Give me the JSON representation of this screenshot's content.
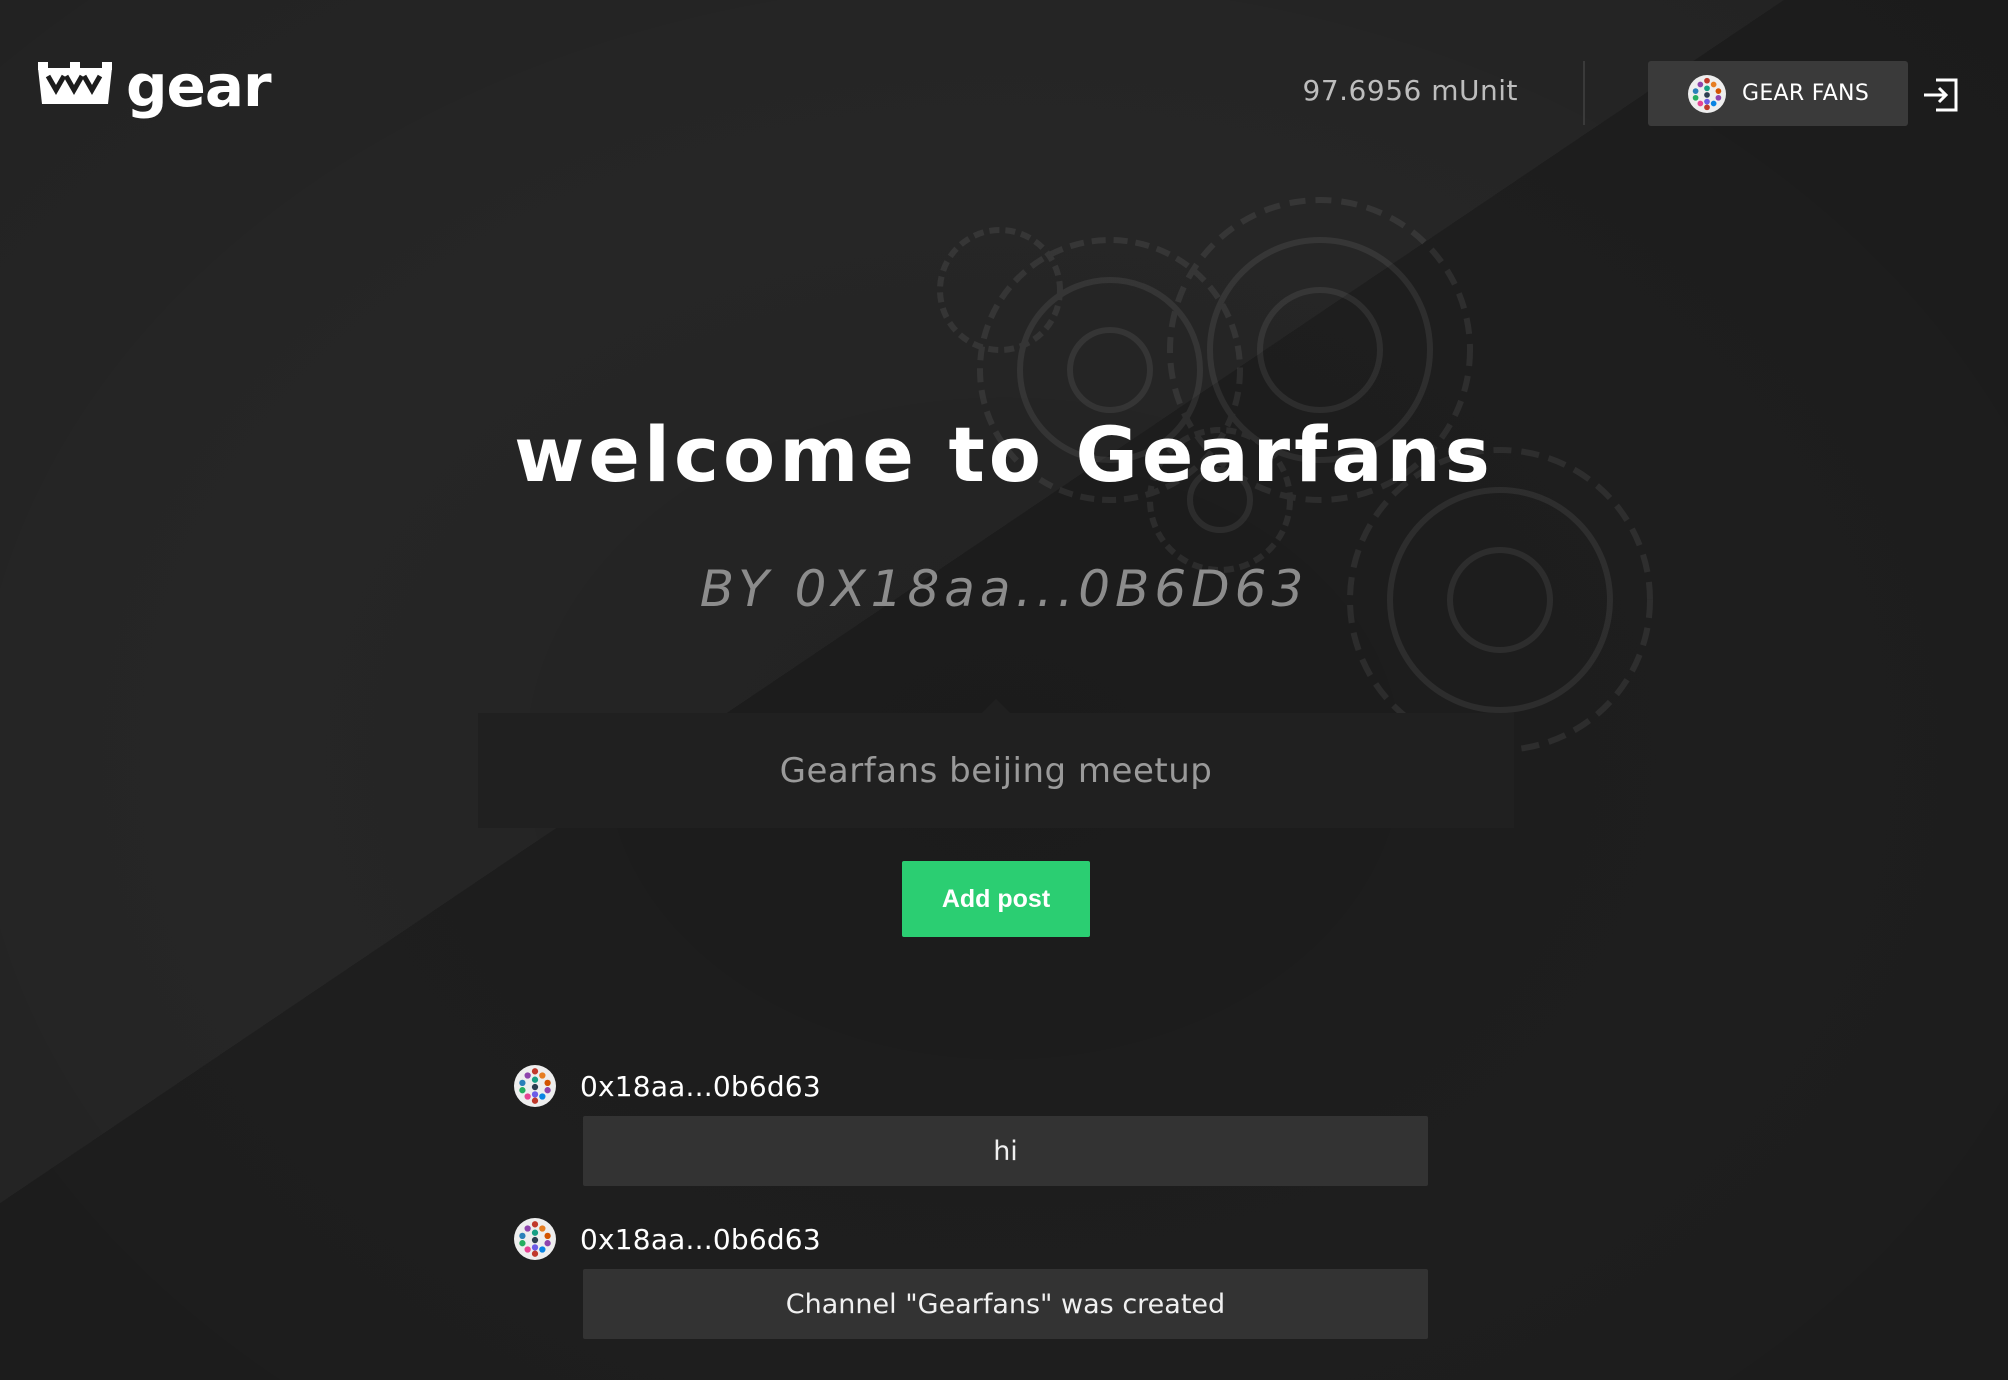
{
  "header": {
    "logo_text": "gear",
    "balance": "97.6956 mUnit",
    "account_name": "GEAR FANS",
    "icons": {
      "logo": "gear-logo-icon",
      "avatar": "polkadot-identicon",
      "logout": "logout-icon"
    }
  },
  "hero": {
    "title": "welcome to Gearfans",
    "owner": "BY 0X18aa...0B6D63",
    "description": "Gearfans beijing meetup",
    "add_post_label": "Add post"
  },
  "posts": [
    {
      "author": "0x18aa...0b6d63",
      "text": "hi"
    },
    {
      "author": "0x18aa...0b6d63",
      "text": "Channel \"Gearfans\" was created"
    }
  ],
  "colors": {
    "background": "#1c1c1c",
    "accent_green": "#2bce72",
    "panel": "#333333",
    "account_button": "#3a3a3a"
  }
}
